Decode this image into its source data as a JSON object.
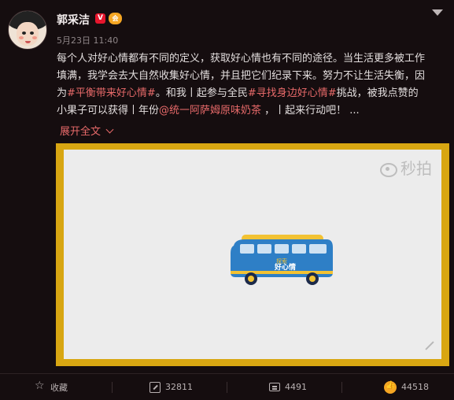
{
  "post": {
    "username": "郭采洁",
    "verified_badge": "V",
    "vip_badge": "会",
    "timestamp": "5月23日 11:40",
    "text": {
      "p1": "每个人对好心情都有不同的定义，获取好心情也有不同的途径。当生活更多被工作填满，我学会去大自然收集好心情，并且把它们纪录下来。努力不让生活失衡，因为",
      "tag1": "#平衡带来好心情#",
      "p2": "。和我丨起参与全民",
      "tag2": "#寻找身边好心情#",
      "p3": "挑战，被我点赞的小果子可以获得丨年份",
      "mention": "@统一阿萨姆原味奶茶",
      "p4": " ，丨起来行动吧！ ..."
    },
    "expand_label": "展开全文"
  },
  "video": {
    "watermark": "秒拍",
    "bus_text": "好心情",
    "bus_text_small": "探索",
    "colors": {
      "frame": "#d8a612",
      "bus_body": "#2e7fc6",
      "bus_roof": "#f2c233"
    }
  },
  "actions": {
    "favorite_label": "收藏",
    "repost_count": "32811",
    "comment_count": "4491",
    "like_count": "44518"
  },
  "colors": {
    "background": "#150d0f",
    "highlight": "#e86a6a",
    "badge_red": "#e6162d"
  }
}
